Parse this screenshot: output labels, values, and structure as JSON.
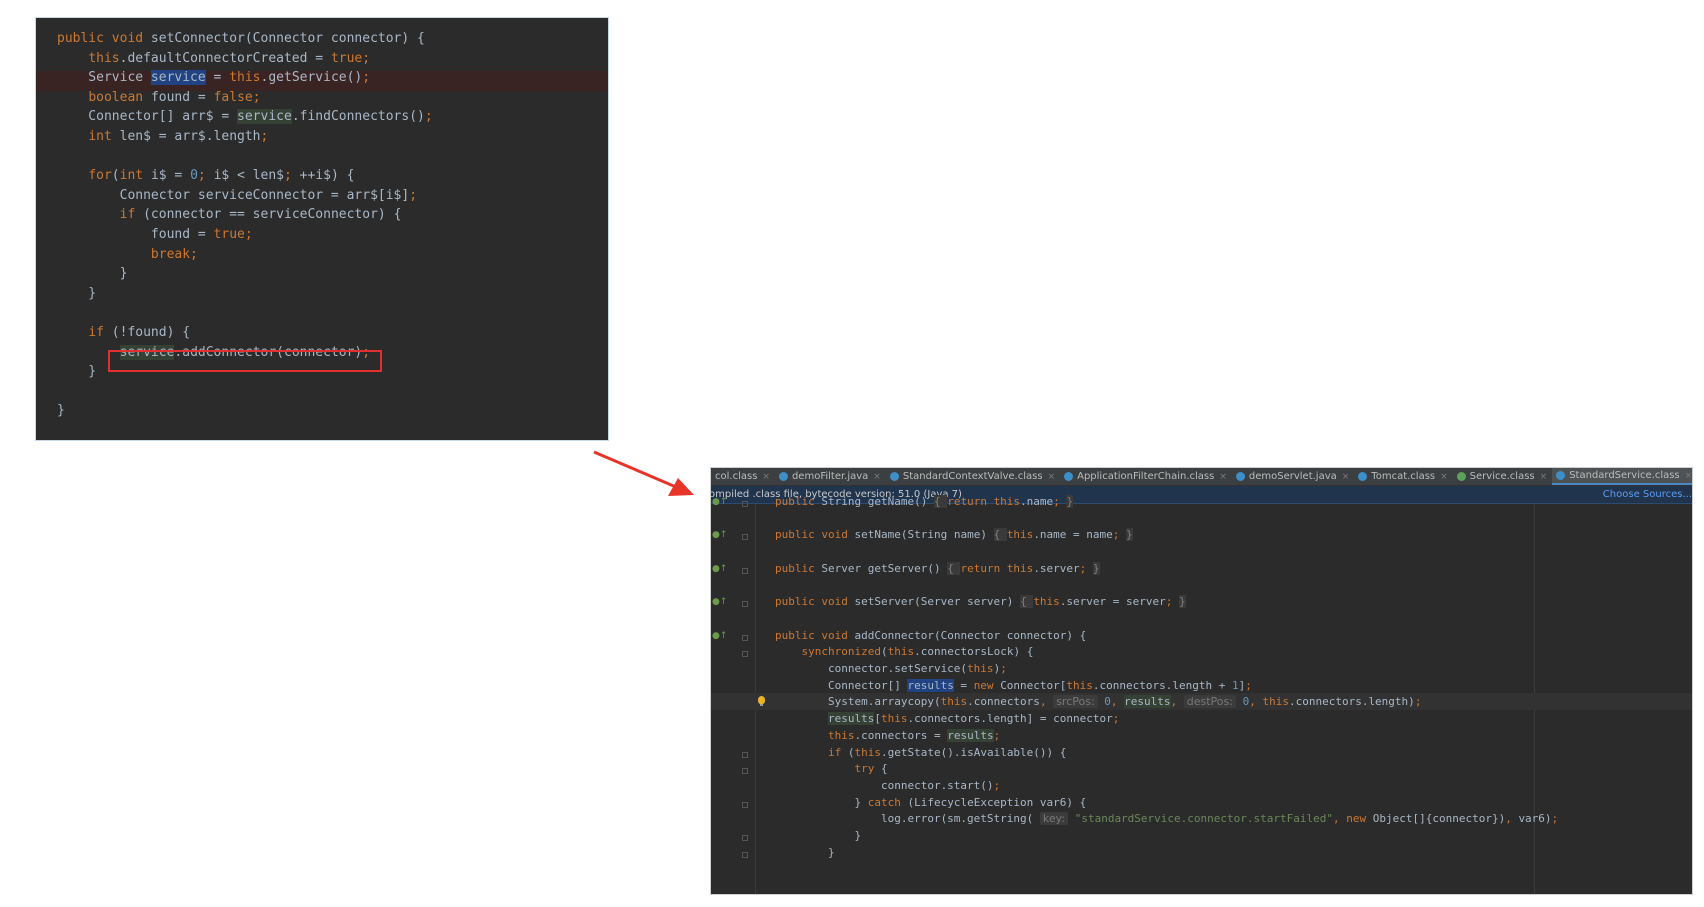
{
  "left_editor": {
    "lines": [
      [
        {
          "t": "public void ",
          "c": "kw"
        },
        {
          "t": "setConnector(Connector connector) {"
        }
      ],
      [
        {
          "t": "    "
        },
        {
          "t": "this",
          "c": "kw"
        },
        {
          "t": ".defaultConnectorCreated = "
        },
        {
          "t": "true",
          "c": "kw"
        },
        {
          "t": ";",
          "c": "kw"
        }
      ],
      [
        {
          "t": "    Service "
        },
        {
          "t": "service",
          "c": "hl-sel"
        },
        {
          "t": " = "
        },
        {
          "t": "this",
          "c": "kw"
        },
        {
          "t": ".getService()"
        },
        {
          "t": ";",
          "c": "kw"
        }
      ],
      [
        {
          "t": "    "
        },
        {
          "t": "boolean ",
          "c": "kw"
        },
        {
          "t": "found = "
        },
        {
          "t": "false",
          "c": "kw"
        },
        {
          "t": ";",
          "c": "kw"
        }
      ],
      [
        {
          "t": "    Connector[] arr$ = "
        },
        {
          "t": "service",
          "c": "hl-green"
        },
        {
          "t": ".findConnectors()"
        },
        {
          "t": ";",
          "c": "kw"
        }
      ],
      [
        {
          "t": "    "
        },
        {
          "t": "int ",
          "c": "kw"
        },
        {
          "t": "len$ = arr$.length"
        },
        {
          "t": ";",
          "c": "kw"
        }
      ],
      [],
      [
        {
          "t": "    "
        },
        {
          "t": "for",
          "c": "kw"
        },
        {
          "t": "("
        },
        {
          "t": "int ",
          "c": "kw"
        },
        {
          "t": "i$ = "
        },
        {
          "t": "0",
          "c": "num"
        },
        {
          "t": "; ",
          "c": "kw"
        },
        {
          "t": "i$ < len$"
        },
        {
          "t": "; ",
          "c": "kw"
        },
        {
          "t": "++i$) {"
        }
      ],
      [
        {
          "t": "        Connector serviceConnector = arr$[i$]"
        },
        {
          "t": ";",
          "c": "kw"
        }
      ],
      [
        {
          "t": "        "
        },
        {
          "t": "if ",
          "c": "kw"
        },
        {
          "t": "(connector == serviceConnector) {"
        }
      ],
      [
        {
          "t": "            found = "
        },
        {
          "t": "true",
          "c": "kw"
        },
        {
          "t": ";",
          "c": "kw"
        }
      ],
      [
        {
          "t": "            "
        },
        {
          "t": "break;",
          "c": "kw"
        }
      ],
      [
        {
          "t": "        }"
        }
      ],
      [
        {
          "t": "    }"
        }
      ],
      [],
      [
        {
          "t": "    "
        },
        {
          "t": "if ",
          "c": "kw"
        },
        {
          "t": "(!found) {"
        }
      ],
      [
        {
          "t": "        "
        },
        {
          "t": "service",
          "c": "hl-green"
        },
        {
          "t": ".addConnector(connector)"
        },
        {
          "t": ";",
          "c": "kw"
        }
      ],
      [
        {
          "t": "    }"
        }
      ],
      [],
      [
        {
          "t": "}"
        }
      ]
    ]
  },
  "right_ide": {
    "tabs": [
      {
        "label": "col.class",
        "icon": "none",
        "active": false
      },
      {
        "label": "demoFilter.java",
        "icon": "class-icon",
        "active": false
      },
      {
        "label": "StandardContextValve.class",
        "icon": "class-icon",
        "active": false
      },
      {
        "label": "ApplicationFilterChain.class",
        "icon": "class-icon",
        "active": false
      },
      {
        "label": "demoServlet.java",
        "icon": "class-icon",
        "active": false
      },
      {
        "label": "Tomcat.class",
        "icon": "class-icon",
        "active": false
      },
      {
        "label": "Service.class",
        "icon": "interface-icon",
        "active": false
      },
      {
        "label": "StandardService.class",
        "icon": "class-icon",
        "active": true
      }
    ],
    "info_bar": {
      "text": "ompiled .class file, bytecode version: 51.0 (Java 7)",
      "action": "Choose Sources..."
    },
    "lines": [
      [
        {
          "t": "public ",
          "c": "kw"
        },
        {
          "t": "String getName() "
        },
        {
          "t": "{ ",
          "c": "brace-box"
        },
        {
          "t": "return ",
          "c": "kw"
        },
        {
          "t": "this",
          "c": "kw"
        },
        {
          "t": ".name"
        },
        {
          "t": "; ",
          "c": "kw"
        },
        {
          "t": "}",
          "c": "brace-box"
        }
      ],
      [],
      [
        {
          "t": "public void ",
          "c": "kw"
        },
        {
          "t": "setName(String name) "
        },
        {
          "t": "{ ",
          "c": "brace-box"
        },
        {
          "t": "this",
          "c": "kw"
        },
        {
          "t": ".name = name"
        },
        {
          "t": "; ",
          "c": "kw"
        },
        {
          "t": "}",
          "c": "brace-box"
        }
      ],
      [],
      [
        {
          "t": "public ",
          "c": "kw"
        },
        {
          "t": "Server getServer() "
        },
        {
          "t": "{ ",
          "c": "brace-box"
        },
        {
          "t": "return ",
          "c": "kw"
        },
        {
          "t": "this",
          "c": "kw"
        },
        {
          "t": ".server"
        },
        {
          "t": "; ",
          "c": "kw"
        },
        {
          "t": "}",
          "c": "brace-box"
        }
      ],
      [],
      [
        {
          "t": "public void ",
          "c": "kw"
        },
        {
          "t": "setServer(Server server) "
        },
        {
          "t": "{ ",
          "c": "brace-box"
        },
        {
          "t": "this",
          "c": "kw"
        },
        {
          "t": ".server = server"
        },
        {
          "t": "; ",
          "c": "kw"
        },
        {
          "t": "}",
          "c": "brace-box"
        }
      ],
      [],
      [
        {
          "t": "public void ",
          "c": "kw"
        },
        {
          "t": "addConnector(Connector connector) {"
        }
      ],
      [
        {
          "t": "    "
        },
        {
          "t": "synchronized",
          "c": "kw"
        },
        {
          "t": "("
        },
        {
          "t": "this",
          "c": "kw"
        },
        {
          "t": ".connectorsLock) {"
        }
      ],
      [
        {
          "t": "        connector.setService("
        },
        {
          "t": "this",
          "c": "kw"
        },
        {
          "t": ")"
        },
        {
          "t": ";",
          "c": "kw"
        }
      ],
      [
        {
          "t": "        Connector[] "
        },
        {
          "t": "results",
          "c": "hl-sel"
        },
        {
          "t": " = "
        },
        {
          "t": "new ",
          "c": "kw"
        },
        {
          "t": "Connector["
        },
        {
          "t": "this",
          "c": "kw"
        },
        {
          "t": ".connectors.length + "
        },
        {
          "t": "1",
          "c": "num"
        },
        {
          "t": "]"
        },
        {
          "t": ";",
          "c": "kw"
        }
      ],
      [
        {
          "t": "        System.arraycopy("
        },
        {
          "t": "this",
          "c": "kw"
        },
        {
          "t": ".connectors"
        },
        {
          "t": ", ",
          "c": "kw"
        },
        {
          "t": "srcPos:",
          "c": "hint"
        },
        {
          "t": " "
        },
        {
          "t": "0",
          "c": "num"
        },
        {
          "t": ", ",
          "c": "kw"
        },
        {
          "t": "results",
          "c": "hl-green"
        },
        {
          "t": ", ",
          "c": "kw"
        },
        {
          "t": "destPos:",
          "c": "hint"
        },
        {
          "t": " "
        },
        {
          "t": "0",
          "c": "num"
        },
        {
          "t": ", ",
          "c": "kw"
        },
        {
          "t": "this",
          "c": "kw"
        },
        {
          "t": ".connectors.length)"
        },
        {
          "t": ";",
          "c": "kw"
        }
      ],
      [
        {
          "t": "        "
        },
        {
          "t": "results",
          "c": "hl-green"
        },
        {
          "t": "["
        },
        {
          "t": "this",
          "c": "kw"
        },
        {
          "t": ".connectors.length] = connector"
        },
        {
          "t": ";",
          "c": "kw"
        }
      ],
      [
        {
          "t": "        "
        },
        {
          "t": "this",
          "c": "kw"
        },
        {
          "t": ".connectors = "
        },
        {
          "t": "results",
          "c": "hl-green"
        },
        {
          "t": ";",
          "c": "kw"
        }
      ],
      [
        {
          "t": "        "
        },
        {
          "t": "if ",
          "c": "kw"
        },
        {
          "t": "("
        },
        {
          "t": "this",
          "c": "kw"
        },
        {
          "t": ".getState().isAvailable()) {"
        }
      ],
      [
        {
          "t": "            "
        },
        {
          "t": "try ",
          "c": "kw"
        },
        {
          "t": "{"
        }
      ],
      [
        {
          "t": "                connector.start()"
        },
        {
          "t": ";",
          "c": "kw"
        }
      ],
      [
        {
          "t": "            } "
        },
        {
          "t": "catch ",
          "c": "kw"
        },
        {
          "t": "(LifecycleException var6) {"
        }
      ],
      [
        {
          "t": "                log.error(sm.getString( "
        },
        {
          "t": "key:",
          "c": "hint"
        },
        {
          "t": " "
        },
        {
          "t": "\"standardService.connector.startFailed\"",
          "c": "str"
        },
        {
          "t": ", ",
          "c": "kw"
        },
        {
          "t": "new ",
          "c": "kw"
        },
        {
          "t": "Object[]{connector})"
        },
        {
          "t": ", ",
          "c": "kw"
        },
        {
          "t": "var6)"
        },
        {
          "t": ";",
          "c": "kw"
        }
      ],
      [
        {
          "t": "            }"
        }
      ],
      [
        {
          "t": "        }"
        }
      ]
    ]
  }
}
